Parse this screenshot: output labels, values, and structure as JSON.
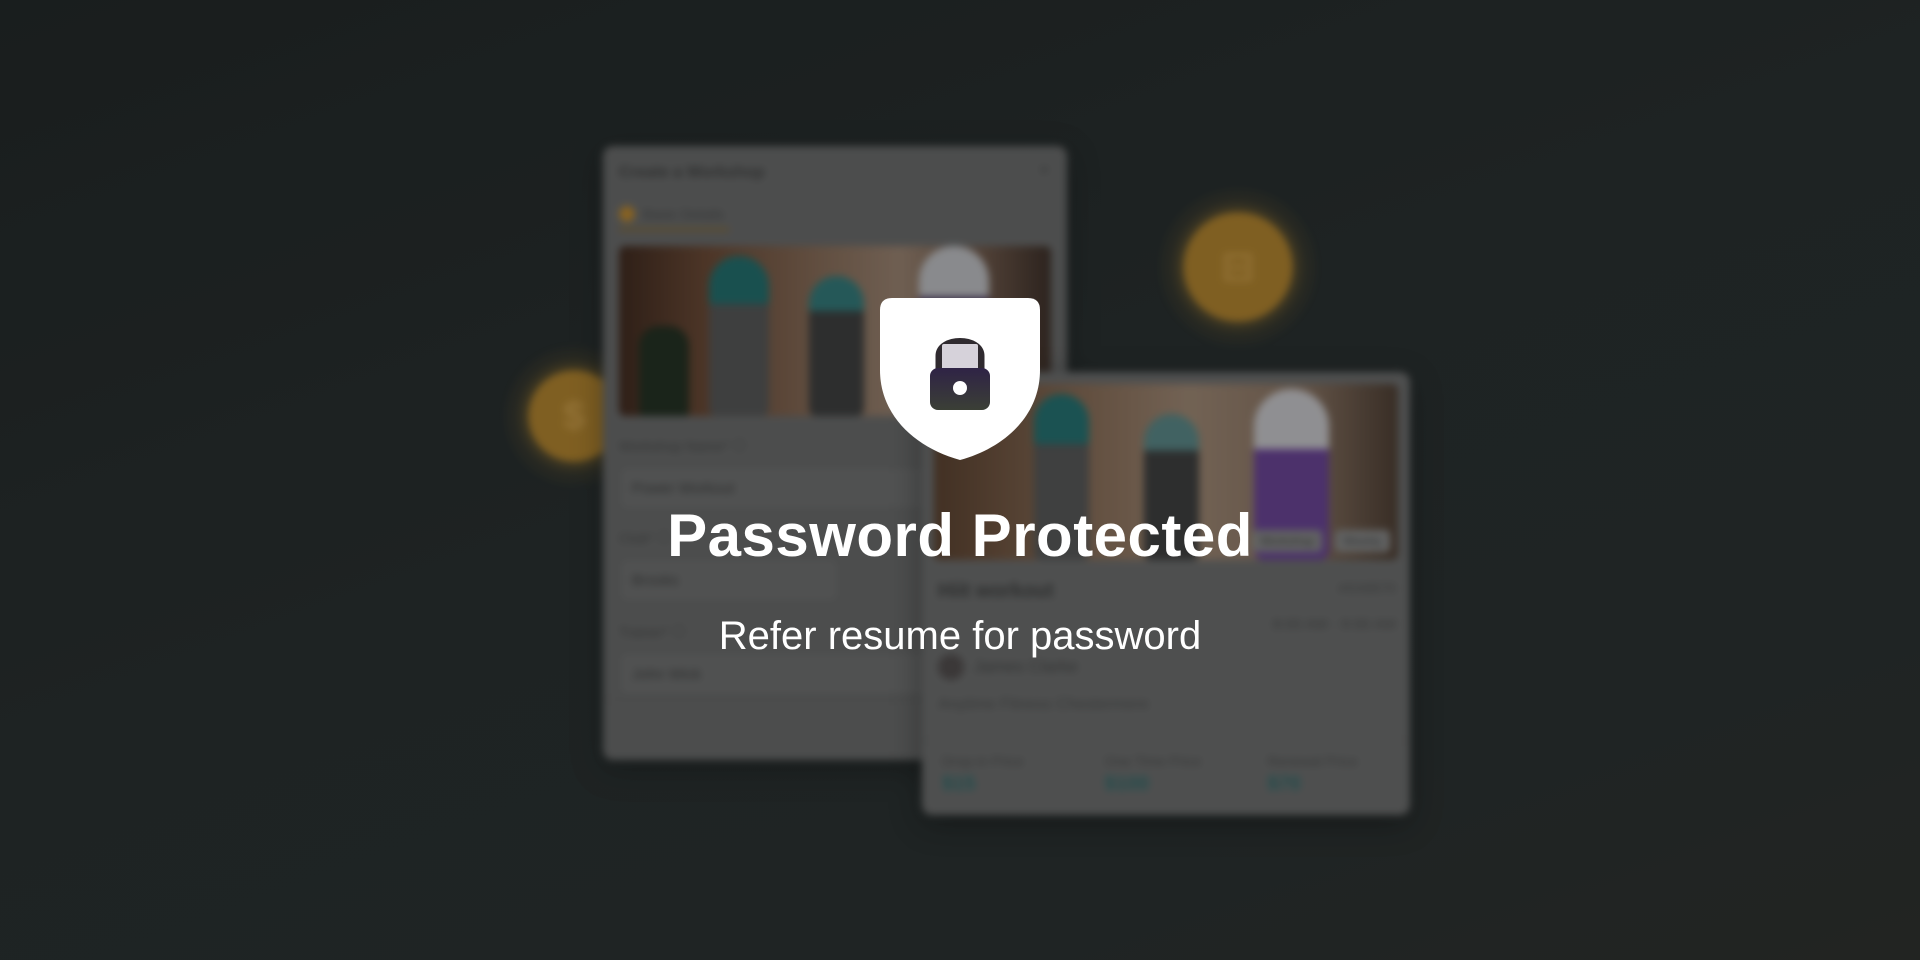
{
  "overlay": {
    "title": "Password Protected",
    "subtitle": "Refer resume for password",
    "icon": "shield-lock-icon"
  },
  "workshop_form": {
    "title": "Create a Workshop",
    "close_label": "×",
    "step_label": "Basic Details",
    "workshop_name_label": "Workshop Name* ⓘ",
    "workshop_name_value": "Power Workout",
    "club_label": "Club* ⓘ",
    "club_value": "Brooks",
    "trainer_label": "Trainer* ⓘ",
    "trainer_value": "John Wick"
  },
  "workshop_card": {
    "title": "Hiit workout",
    "code": "#SX8570",
    "time": "8:00 AM - 9:00 AM",
    "trainer": "James Clarke",
    "location": "Anytime Fitness Chestermere",
    "tags": [
      "Workshop",
      "Weekly"
    ],
    "prices": [
      {
        "label": "Drop-in Price",
        "value": "$15"
      },
      {
        "label": "One Time Price",
        "value": "$100"
      },
      {
        "label": "Renewal Price",
        "value": "$70"
      }
    ]
  },
  "colors": {
    "background": "#222828",
    "coin": "#b98628",
    "price_accent": "#2a6a6a",
    "overlay_text": "#ffffff"
  }
}
